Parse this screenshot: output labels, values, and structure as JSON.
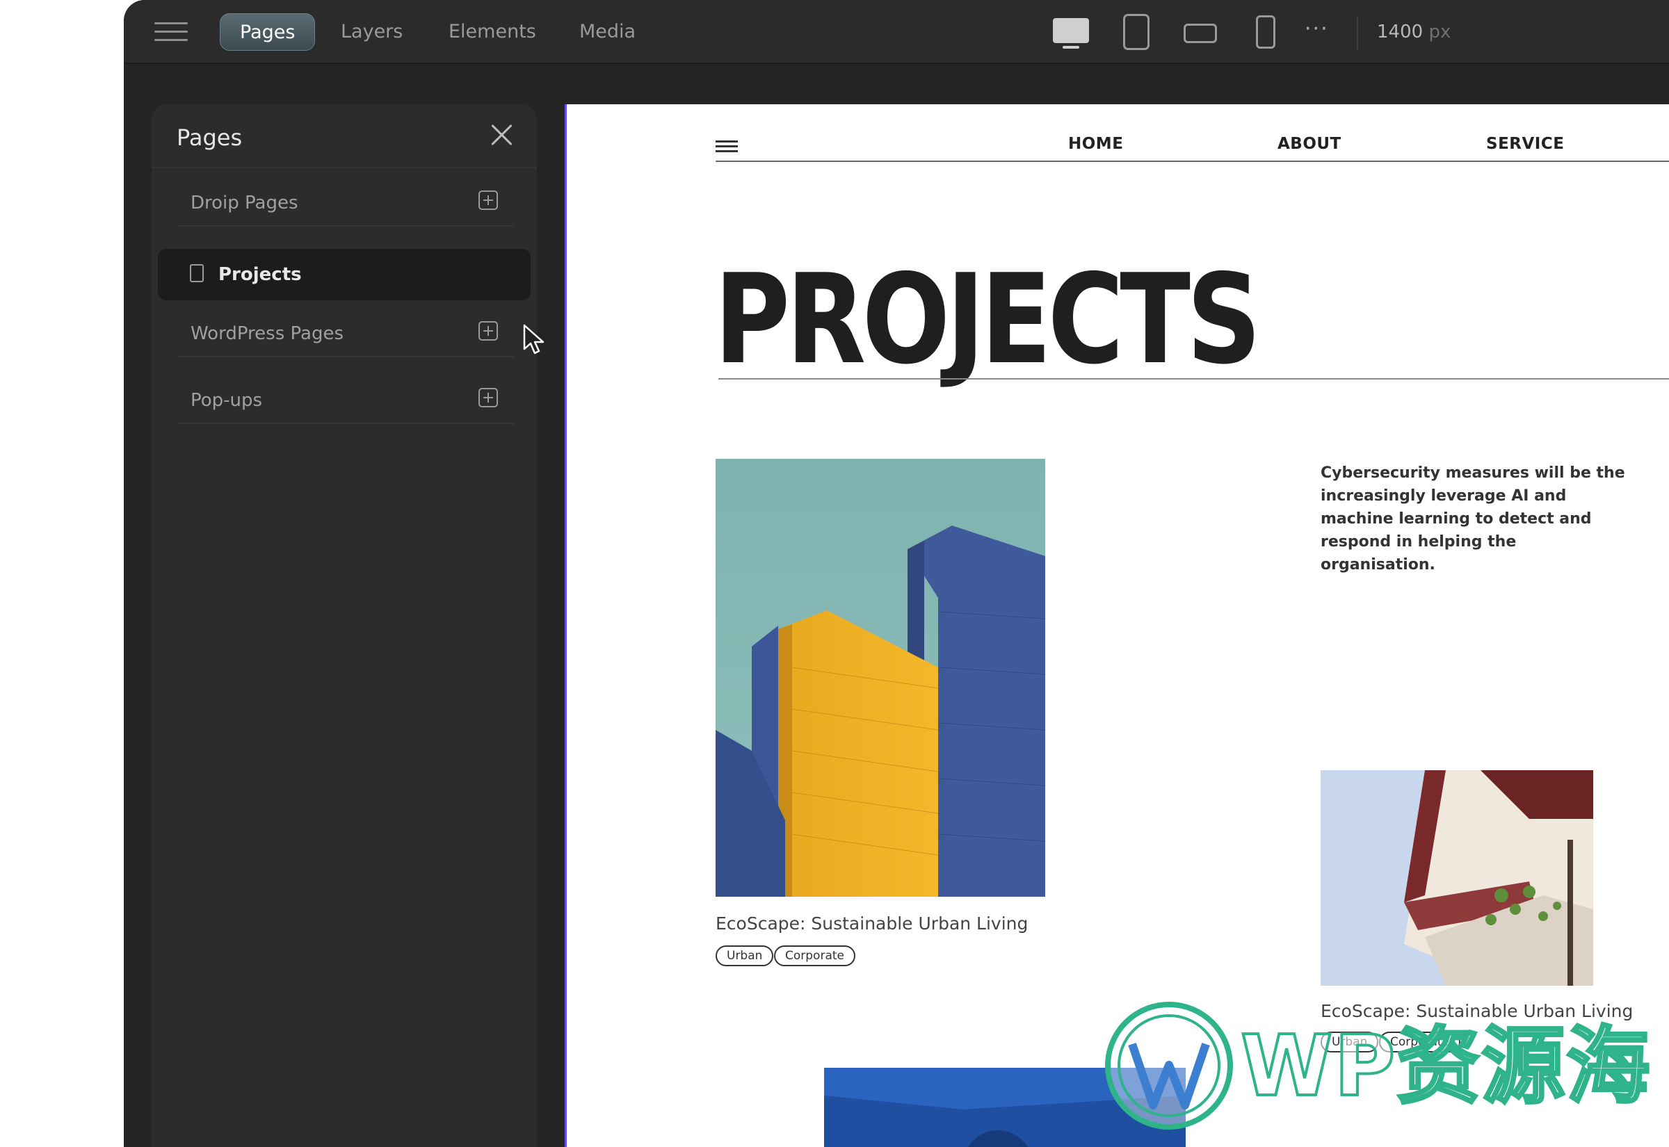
{
  "toolbar": {
    "tabs": [
      "Pages",
      "Layers",
      "Elements",
      "Media"
    ],
    "more_label": "···",
    "width_value": "1400",
    "width_unit": "px"
  },
  "pages_panel": {
    "title": "Pages",
    "items": [
      {
        "label": "Droip Pages"
      },
      {
        "label": "Projects"
      },
      {
        "label": "WordPress Pages"
      },
      {
        "label": "Pop-ups"
      }
    ]
  },
  "site": {
    "nav": [
      "HOME",
      "ABOUT",
      "SERVICE"
    ],
    "hero_title": "PROJECTS",
    "description": "Cybersecurity measures will be the increasingly leverage AI and machine learning to detect and respond in helping the organisation.",
    "cards": [
      {
        "title": "EcoScape: Sustainable Urban Living",
        "tags": [
          "Urban",
          "Corporate"
        ]
      },
      {
        "title": "EcoScape: Sustainable Urban Living",
        "tags": [
          "Urban",
          "Corporate"
        ]
      }
    ]
  },
  "watermark": {
    "text": "WP资源海"
  },
  "colors": {
    "accent": "#6a4cff",
    "panel_bg": "#2c2c2c",
    "app_bg": "#242424",
    "watermark": "#2fb38a"
  }
}
